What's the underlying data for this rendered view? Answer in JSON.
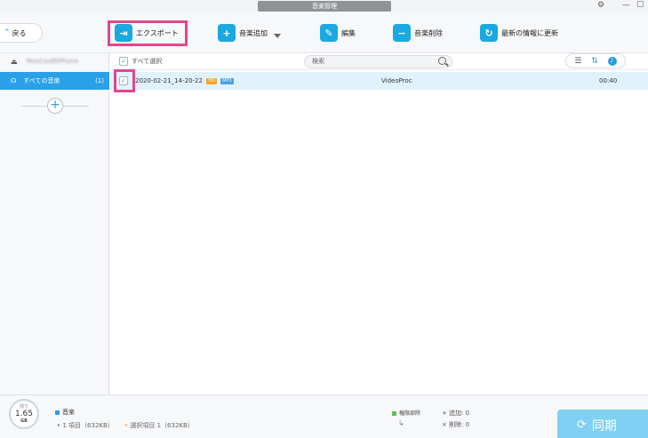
{
  "window": {
    "title": "音楽管理",
    "controls": [
      "⚙",
      "—",
      "☐"
    ]
  },
  "toolbar": {
    "back_label": "戻る",
    "export_label": "エクスポート",
    "add_music_label": "音楽追加",
    "edit_label": "編集",
    "delete_label": "音楽削除",
    "refresh_label": "最新の情報に更新"
  },
  "sidebar": {
    "device_name": "MooCoo的iPhone",
    "active_item": {
      "label": "すべての音楽",
      "count": "(1)"
    }
  },
  "list": {
    "select_all_label": "すべて選択",
    "search_placeholder": "検索",
    "rows": [
      {
        "name": "2020-02-21_14-20-22",
        "badge_hd": "HD",
        "badge_format": "MP3",
        "artist": "VideoProc",
        "duration": "00:40"
      }
    ]
  },
  "footer": {
    "storage_label": "残り",
    "storage_value": "1.65",
    "storage_unit": "GB",
    "music_label": "音楽",
    "items_text": "1 項目（632KB）",
    "selected_text": "選択項目 1（632KB）",
    "sync_section_label": "権限部除",
    "added_text": "追加:  0",
    "removed_text": "削除:  0",
    "sync_label": "同期"
  },
  "colors": {
    "accent": "#1aa9e0",
    "highlight": "#e0468f",
    "selected_row": "#e0f2fc",
    "music_legend": "#2aa0e8",
    "sync_legend": "#5cc25c"
  }
}
